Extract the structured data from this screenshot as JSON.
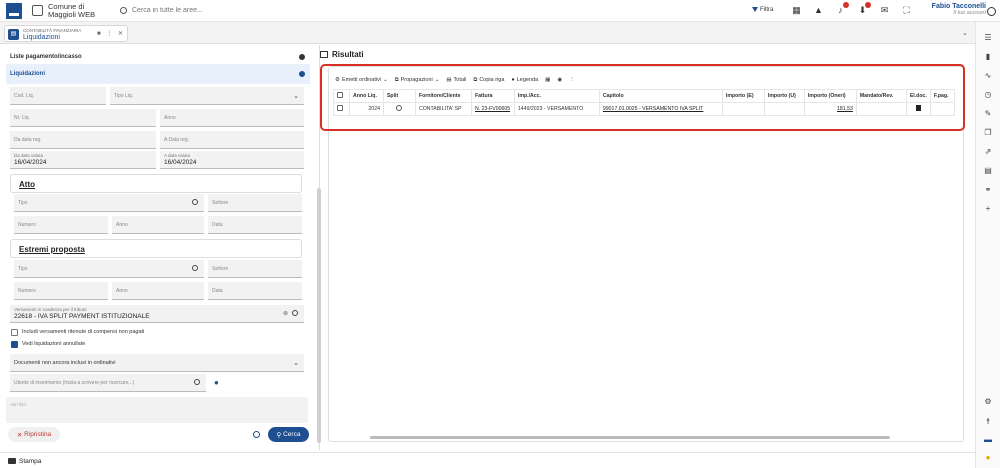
{
  "app": {
    "name": "Comune di\nMaggioli WEB",
    "search_placeholder": "Cerca in tutte le aree..."
  },
  "header": {
    "filter_label": "Filtra",
    "user_name": "Fabio Tacconelli",
    "user_role": "Il tuo account"
  },
  "tab": {
    "module": "CONTABILITÀ FINANZIARIA",
    "title": "Liquidazioni"
  },
  "left": {
    "section1": "Liste pagamento/incasso",
    "section2": "Liquidazioni",
    "fields": {
      "cod_liq": "Cod. Liq.",
      "tipo_liq": "Tipo Liq.",
      "nr_liq": "Nr. Liq.",
      "anno": "Anno",
      "da_data_reg": "Da data reg.",
      "a_data_reg": "A Data reg.",
      "da_data_valuta_label": "Da data valuta",
      "da_data_valuta": "16/04/2024",
      "a_data_valuta_label": "A data valuta",
      "a_data_valuta": "16/04/2024"
    },
    "atto": {
      "title": "Atto",
      "tipo": "Tipo",
      "settore": "Settore",
      "numero": "Numero",
      "anno": "Anno",
      "data": "Data"
    },
    "estremi": {
      "title": "Estremi proposta",
      "tipo": "Tipo",
      "settore": "Settore",
      "numero": "Numero",
      "anno": "Anno",
      "data": "Data"
    },
    "versamenti_label": "Versamenti in scadenza per il tributo",
    "versamenti_value": "22618 - IVA SPLIT PAYMENT ISTITUZIONALE",
    "cb1": "Includi versamenti ritenute di compensi non pagati",
    "cb2": "Vedi liquidazioni annullate",
    "documenti": "Documenti non ancora inclusi in ordinativi",
    "utente_placeholder": "Utente di inserimento (Inizia a scrivere per ricercare...)",
    "altri_filtri": "Altri filtri",
    "reset_label": "Ripristina",
    "search_label": "Cerca"
  },
  "results": {
    "title": "Risultati",
    "toolbar": [
      "Emetti ordinativi",
      "Propagazioni",
      "Totali",
      "Copia riga",
      "Legenda"
    ],
    "columns": [
      "Anno Liq.",
      "Split",
      "Fornitore/Cliente",
      "Fattura",
      "Imp./Acc.",
      "Capitolo",
      "Importo (E)",
      "Importo (U)",
      "Importo (Oneri)",
      "Mandato/Rev.",
      "El.doc.",
      "F.pag."
    ],
    "rows": [
      {
        "anno": "2024",
        "fornitore": "CONTABILITA' SP",
        "fattura": "N. 23-FV00605",
        "imp": "1449/2023 - VERSAMENTO",
        "capitolo": "99017.01.0025 - VERSAMENTO IVA SPLIT",
        "importo_e": "",
        "importo_u": "",
        "importo_oneri": "181,53",
        "mandato": ""
      }
    ]
  },
  "footer": {
    "print_label": "Stampa"
  }
}
